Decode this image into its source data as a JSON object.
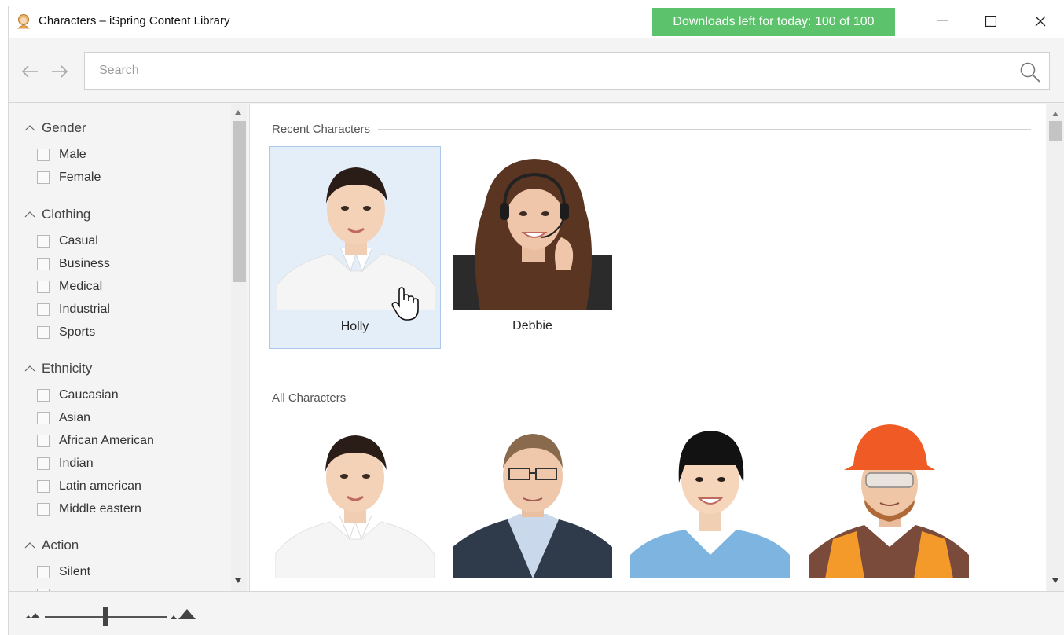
{
  "window": {
    "title": "Characters – iSpring Content Library",
    "downloads_badge": "Downloads left for today: 100 of 100",
    "badge_color": "#5dc26c"
  },
  "toolbar": {
    "search_placeholder": "Search",
    "search_value": ""
  },
  "filters": {
    "groups": [
      {
        "title": "Gender",
        "items": [
          "Male",
          "Female"
        ]
      },
      {
        "title": "Clothing",
        "items": [
          "Casual",
          "Business",
          "Medical",
          "Industrial",
          "Sports"
        ]
      },
      {
        "title": "Ethnicity",
        "items": [
          "Caucasian",
          "Asian",
          "African American",
          "Indian",
          "Latin american",
          "Middle eastern"
        ]
      },
      {
        "title": "Action",
        "items": [
          "Silent"
        ]
      }
    ]
  },
  "main": {
    "recent": {
      "title": "Recent Characters",
      "cards": [
        {
          "name": "Holly",
          "selected": true
        },
        {
          "name": "Debbie",
          "selected": false
        }
      ]
    },
    "all": {
      "title": "All Characters",
      "cards": [
        {
          "name": ""
        },
        {
          "name": ""
        },
        {
          "name": ""
        },
        {
          "name": ""
        }
      ]
    }
  },
  "footer": {
    "zoom_level": 0.5
  },
  "colors": {
    "selected_card_bg": "#e4eef9",
    "selected_card_border": "#a9c8ea"
  }
}
